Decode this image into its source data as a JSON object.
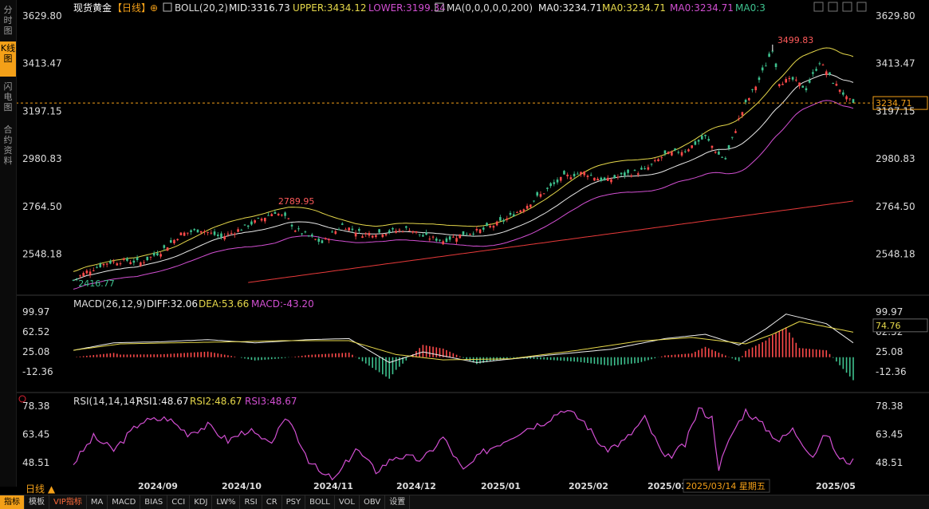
{
  "sidebar": {
    "tabs": [
      {
        "label": "分时图",
        "active": false,
        "top": 4,
        "h": 40
      },
      {
        "label": "K线图",
        "active": true,
        "top": 52,
        "h": 44
      },
      {
        "label": "闪电图",
        "active": false,
        "top": 100,
        "h": 44
      },
      {
        "label": "合约资料",
        "active": false,
        "top": 154,
        "h": 58
      }
    ]
  },
  "header": {
    "title": "现货黄金",
    "period_tag": "【日线】",
    "add_icon": "⊕",
    "boll": "BOLL(20,2)",
    "boll_mid": "MID:3316.73",
    "boll_upper": "UPPER:3434.12",
    "boll_lower": "LOWER:3199.34",
    "ma": "MA(0,0,0,0,0,200)",
    "ma0a": "MA0:3234.71",
    "ma0b": "MA0:3234.71",
    "ma0c": "MA0:3234.71",
    "ma0d": "MA0:3"
  },
  "macd_header": {
    "name": "MACD(26,12,9)",
    "diff": "DIFF:32.06",
    "dea": "DEA:53.66",
    "macd": "MACD:-43.20"
  },
  "rsi_header": {
    "name": "RSI(14,14,14)",
    "rsi1": "RSI1:48.67",
    "rsi2": "RSI2:48.67",
    "rsi3": "RSI3:48.67"
  },
  "bottom_bar": {
    "period": "日线 ▲",
    "items": [
      "指标",
      "模板",
      "VIP指标",
      "MA",
      "MACD",
      "BIAS",
      "CCI",
      "KDJ",
      "LW%",
      "RSI",
      "CR",
      "PSY",
      "BOLL",
      "VOL",
      "OBV",
      "设置"
    ]
  },
  "colors": {
    "up": "#ff4a4a",
    "down": "#3ec28f",
    "boll_mid": "#e8e8e8",
    "boll_upper": "#e6d84a",
    "boll_lower": "#d24fd2",
    "ma200": "#e83a3a",
    "dea": "#e6d84a",
    "accent": "#f4a018"
  },
  "chart_data": [
    {
      "type": "candlestick",
      "x_labels": [
        "2024/09",
        "2024/10",
        "2024/11",
        "2024/12",
        "2025/01",
        "2025/02",
        "2025/03",
        "2025/05"
      ],
      "y_ticks": [
        "3629.80",
        "3413.47",
        "3197.15",
        "2980.83",
        "2764.50",
        "2548.18"
      ],
      "ylim": [
        2416.77,
        3629.8
      ],
      "current_price": "3234.71",
      "annotations": {
        "high": "3499.83",
        "mid_high": "2789.95",
        "low": "2416.77"
      },
      "crosshair_date": "2025/03/14 星期五",
      "price_anchors": [
        [
          0,
          2430
        ],
        [
          4,
          2470
        ],
        [
          10,
          2510
        ],
        [
          16,
          2520
        ],
        [
          20,
          2510
        ],
        [
          26,
          2560
        ],
        [
          32,
          2640
        ],
        [
          38,
          2660
        ],
        [
          44,
          2625
        ],
        [
          50,
          2665
        ],
        [
          56,
          2710
        ],
        [
          60,
          2740
        ],
        [
          64,
          2705
        ],
        [
          66,
          2660
        ],
        [
          70,
          2630
        ],
        [
          74,
          2600
        ],
        [
          80,
          2680
        ],
        [
          86,
          2640
        ],
        [
          94,
          2650
        ],
        [
          100,
          2665
        ],
        [
          104,
          2630
        ],
        [
          110,
          2610
        ],
        [
          116,
          2640
        ],
        [
          122,
          2660
        ],
        [
          128,
          2700
        ],
        [
          134,
          2760
        ],
        [
          140,
          2830
        ],
        [
          146,
          2900
        ],
        [
          152,
          2920
        ],
        [
          158,
          2880
        ],
        [
          164,
          2910
        ],
        [
          170,
          2930
        ],
        [
          176,
          3000
        ],
        [
          182,
          3020
        ],
        [
          188,
          3080
        ],
        [
          192,
          3000
        ],
        [
          194,
          2980
        ],
        [
          198,
          3160
        ],
        [
          200,
          3230
        ],
        [
          204,
          3340
        ],
        [
          208,
          3480
        ],
        [
          210,
          3330
        ],
        [
          214,
          3340
        ],
        [
          218,
          3300
        ],
        [
          222,
          3420
        ],
        [
          224,
          3380
        ],
        [
          226,
          3330
        ],
        [
          228,
          3300
        ],
        [
          230,
          3255
        ],
        [
          232,
          3234.71
        ]
      ],
      "boll_width_anchors": [
        [
          0,
          80
        ],
        [
          30,
          90
        ],
        [
          60,
          150
        ],
        [
          90,
          70
        ],
        [
          120,
          90
        ],
        [
          150,
          140
        ],
        [
          180,
          150
        ],
        [
          200,
          250
        ],
        [
          232,
          235
        ]
      ],
      "ma200_anchors": [
        [
          52,
          2420
        ],
        [
          232,
          2790
        ]
      ],
      "series": [
        {
          "name": "BOLL MID"
        },
        {
          "name": "UPPER"
        },
        {
          "name": "LOWER"
        },
        {
          "name": "MA0"
        }
      ]
    },
    {
      "type": "bar",
      "yticks": [
        "99.97",
        "62.52",
        "25.08",
        "-12.36"
      ],
      "ylim": [
        -12.36,
        99.97
      ],
      "current": "74.76",
      "diff_anchors": [
        [
          0,
          28
        ],
        [
          12,
          42
        ],
        [
          26,
          44
        ],
        [
          40,
          48
        ],
        [
          54,
          42
        ],
        [
          70,
          48
        ],
        [
          82,
          50
        ],
        [
          94,
          5
        ],
        [
          104,
          25
        ],
        [
          120,
          5
        ],
        [
          140,
          18
        ],
        [
          160,
          30
        ],
        [
          176,
          50
        ],
        [
          188,
          58
        ],
        [
          198,
          38
        ],
        [
          206,
          68
        ],
        [
          212,
          96
        ],
        [
          224,
          78
        ],
        [
          232,
          42
        ]
      ],
      "dea_anchors": [
        [
          0,
          28
        ],
        [
          14,
          40
        ],
        [
          30,
          42
        ],
        [
          48,
          44
        ],
        [
          62,
          46
        ],
        [
          82,
          46
        ],
        [
          96,
          20
        ],
        [
          110,
          10
        ],
        [
          130,
          12
        ],
        [
          150,
          28
        ],
        [
          168,
          45
        ],
        [
          184,
          52
        ],
        [
          200,
          40
        ],
        [
          208,
          58
        ],
        [
          216,
          82
        ],
        [
          232,
          62
        ]
      ]
    },
    {
      "type": "line",
      "yticks": [
        "78.38",
        "63.45",
        "48.51"
      ],
      "ylim": [
        40,
        80
      ],
      "anchors": [
        [
          0,
          48
        ],
        [
          6,
          62
        ],
        [
          12,
          55
        ],
        [
          20,
          70
        ],
        [
          28,
          72
        ],
        [
          34,
          64
        ],
        [
          40,
          68
        ],
        [
          46,
          60
        ],
        [
          52,
          66
        ],
        [
          58,
          58
        ],
        [
          64,
          72
        ],
        [
          70,
          50
        ],
        [
          74,
          42
        ],
        [
          78,
          40
        ],
        [
          84,
          56
        ],
        [
          90,
          44
        ],
        [
          96,
          52
        ],
        [
          104,
          50
        ],
        [
          110,
          62
        ],
        [
          116,
          44
        ],
        [
          122,
          54
        ],
        [
          128,
          60
        ],
        [
          134,
          66
        ],
        [
          140,
          70
        ],
        [
          146,
          77
        ],
        [
          152,
          70
        ],
        [
          158,
          55
        ],
        [
          164,
          60
        ],
        [
          170,
          72
        ],
        [
          176,
          50
        ],
        [
          182,
          58
        ],
        [
          186,
          77
        ],
        [
          190,
          72
        ],
        [
          192,
          46
        ],
        [
          196,
          64
        ],
        [
          200,
          76
        ],
        [
          204,
          70
        ],
        [
          210,
          60
        ],
        [
          214,
          66
        ],
        [
          220,
          52
        ],
        [
          224,
          64
        ],
        [
          228,
          50
        ],
        [
          232,
          49
        ]
      ]
    }
  ]
}
